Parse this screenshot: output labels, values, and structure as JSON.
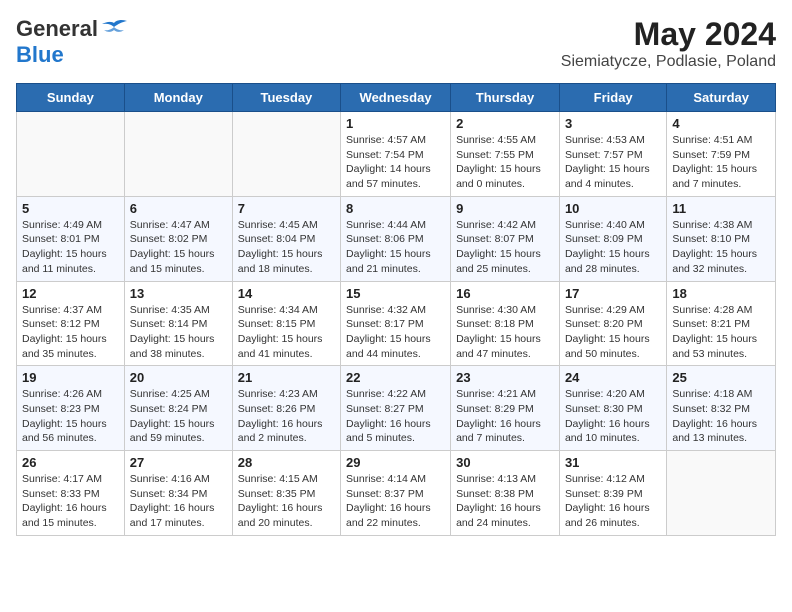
{
  "header": {
    "logo_general": "General",
    "logo_blue": "Blue",
    "month_year": "May 2024",
    "location": "Siemiatycze, Podlasie, Poland"
  },
  "weekdays": [
    "Sunday",
    "Monday",
    "Tuesday",
    "Wednesday",
    "Thursday",
    "Friday",
    "Saturday"
  ],
  "weeks": [
    [
      {
        "day": "",
        "info": ""
      },
      {
        "day": "",
        "info": ""
      },
      {
        "day": "",
        "info": ""
      },
      {
        "day": "1",
        "info": "Sunrise: 4:57 AM\nSunset: 7:54 PM\nDaylight: 14 hours\nand 57 minutes."
      },
      {
        "day": "2",
        "info": "Sunrise: 4:55 AM\nSunset: 7:55 PM\nDaylight: 15 hours\nand 0 minutes."
      },
      {
        "day": "3",
        "info": "Sunrise: 4:53 AM\nSunset: 7:57 PM\nDaylight: 15 hours\nand 4 minutes."
      },
      {
        "day": "4",
        "info": "Sunrise: 4:51 AM\nSunset: 7:59 PM\nDaylight: 15 hours\nand 7 minutes."
      }
    ],
    [
      {
        "day": "5",
        "info": "Sunrise: 4:49 AM\nSunset: 8:01 PM\nDaylight: 15 hours\nand 11 minutes."
      },
      {
        "day": "6",
        "info": "Sunrise: 4:47 AM\nSunset: 8:02 PM\nDaylight: 15 hours\nand 15 minutes."
      },
      {
        "day": "7",
        "info": "Sunrise: 4:45 AM\nSunset: 8:04 PM\nDaylight: 15 hours\nand 18 minutes."
      },
      {
        "day": "8",
        "info": "Sunrise: 4:44 AM\nSunset: 8:06 PM\nDaylight: 15 hours\nand 21 minutes."
      },
      {
        "day": "9",
        "info": "Sunrise: 4:42 AM\nSunset: 8:07 PM\nDaylight: 15 hours\nand 25 minutes."
      },
      {
        "day": "10",
        "info": "Sunrise: 4:40 AM\nSunset: 8:09 PM\nDaylight: 15 hours\nand 28 minutes."
      },
      {
        "day": "11",
        "info": "Sunrise: 4:38 AM\nSunset: 8:10 PM\nDaylight: 15 hours\nand 32 minutes."
      }
    ],
    [
      {
        "day": "12",
        "info": "Sunrise: 4:37 AM\nSunset: 8:12 PM\nDaylight: 15 hours\nand 35 minutes."
      },
      {
        "day": "13",
        "info": "Sunrise: 4:35 AM\nSunset: 8:14 PM\nDaylight: 15 hours\nand 38 minutes."
      },
      {
        "day": "14",
        "info": "Sunrise: 4:34 AM\nSunset: 8:15 PM\nDaylight: 15 hours\nand 41 minutes."
      },
      {
        "day": "15",
        "info": "Sunrise: 4:32 AM\nSunset: 8:17 PM\nDaylight: 15 hours\nand 44 minutes."
      },
      {
        "day": "16",
        "info": "Sunrise: 4:30 AM\nSunset: 8:18 PM\nDaylight: 15 hours\nand 47 minutes."
      },
      {
        "day": "17",
        "info": "Sunrise: 4:29 AM\nSunset: 8:20 PM\nDaylight: 15 hours\nand 50 minutes."
      },
      {
        "day": "18",
        "info": "Sunrise: 4:28 AM\nSunset: 8:21 PM\nDaylight: 15 hours\nand 53 minutes."
      }
    ],
    [
      {
        "day": "19",
        "info": "Sunrise: 4:26 AM\nSunset: 8:23 PM\nDaylight: 15 hours\nand 56 minutes."
      },
      {
        "day": "20",
        "info": "Sunrise: 4:25 AM\nSunset: 8:24 PM\nDaylight: 15 hours\nand 59 minutes."
      },
      {
        "day": "21",
        "info": "Sunrise: 4:23 AM\nSunset: 8:26 PM\nDaylight: 16 hours\nand 2 minutes."
      },
      {
        "day": "22",
        "info": "Sunrise: 4:22 AM\nSunset: 8:27 PM\nDaylight: 16 hours\nand 5 minutes."
      },
      {
        "day": "23",
        "info": "Sunrise: 4:21 AM\nSunset: 8:29 PM\nDaylight: 16 hours\nand 7 minutes."
      },
      {
        "day": "24",
        "info": "Sunrise: 4:20 AM\nSunset: 8:30 PM\nDaylight: 16 hours\nand 10 minutes."
      },
      {
        "day": "25",
        "info": "Sunrise: 4:18 AM\nSunset: 8:32 PM\nDaylight: 16 hours\nand 13 minutes."
      }
    ],
    [
      {
        "day": "26",
        "info": "Sunrise: 4:17 AM\nSunset: 8:33 PM\nDaylight: 16 hours\nand 15 minutes."
      },
      {
        "day": "27",
        "info": "Sunrise: 4:16 AM\nSunset: 8:34 PM\nDaylight: 16 hours\nand 17 minutes."
      },
      {
        "day": "28",
        "info": "Sunrise: 4:15 AM\nSunset: 8:35 PM\nDaylight: 16 hours\nand 20 minutes."
      },
      {
        "day": "29",
        "info": "Sunrise: 4:14 AM\nSunset: 8:37 PM\nDaylight: 16 hours\nand 22 minutes."
      },
      {
        "day": "30",
        "info": "Sunrise: 4:13 AM\nSunset: 8:38 PM\nDaylight: 16 hours\nand 24 minutes."
      },
      {
        "day": "31",
        "info": "Sunrise: 4:12 AM\nSunset: 8:39 PM\nDaylight: 16 hours\nand 26 minutes."
      },
      {
        "day": "",
        "info": ""
      }
    ]
  ]
}
